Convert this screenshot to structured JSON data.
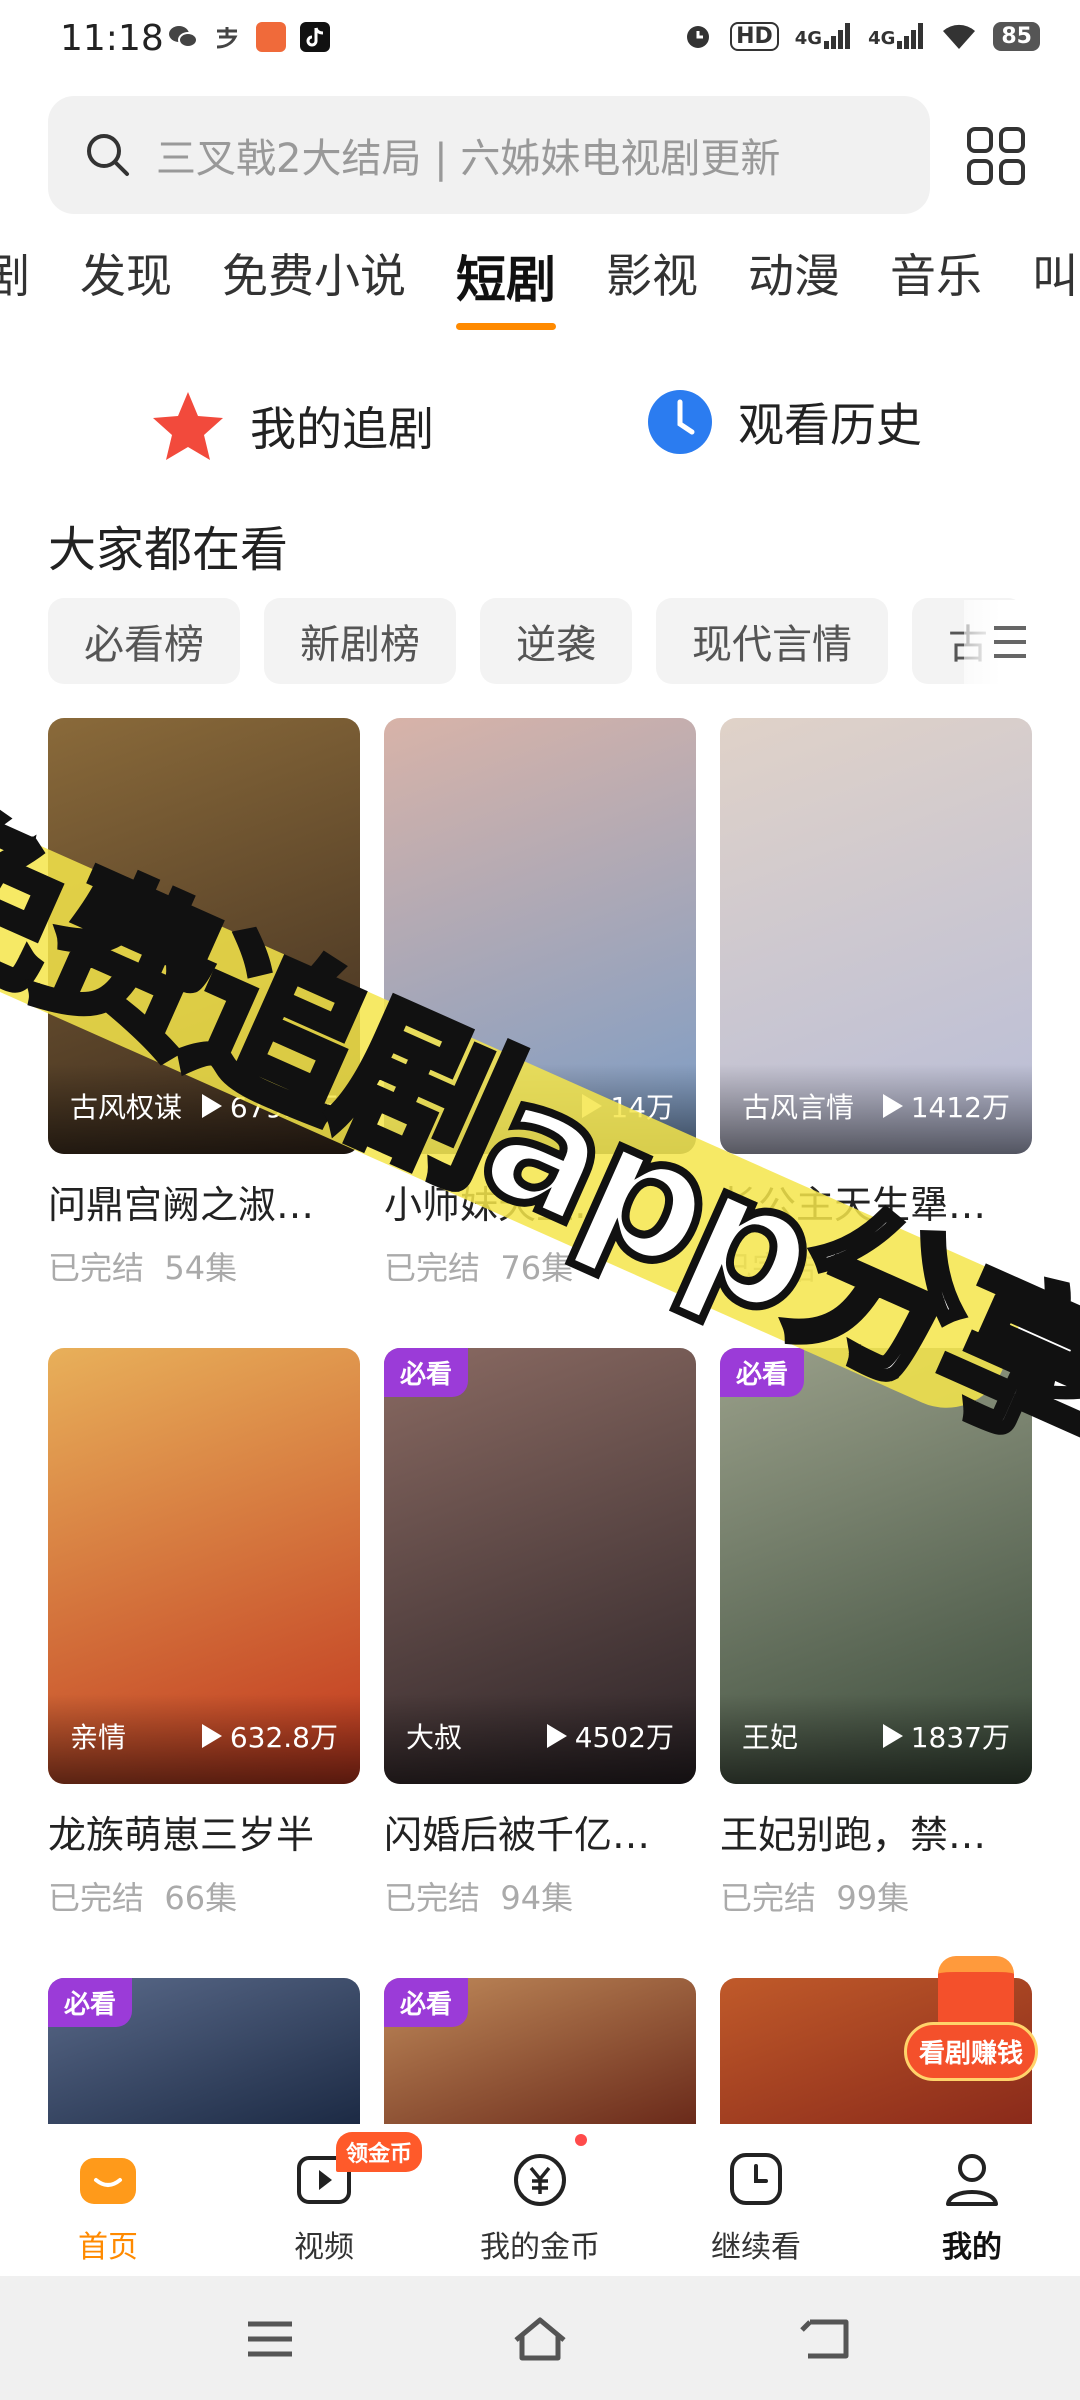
{
  "status_bar": {
    "time": "11:18",
    "battery": "85",
    "network_1": "4G",
    "network_2": "4G",
    "hd": "HD"
  },
  "search": {
    "placeholder": "三叉戟2大结局 | 六姊妹电视剧更新"
  },
  "tabs": [
    {
      "label": "剧",
      "active": false
    },
    {
      "label": "发现",
      "active": false
    },
    {
      "label": "免费小说",
      "active": false
    },
    {
      "label": "短剧",
      "active": true
    },
    {
      "label": "影视",
      "active": false
    },
    {
      "label": "动漫",
      "active": false
    },
    {
      "label": "音乐",
      "active": false
    },
    {
      "label": "叫",
      "active": false
    }
  ],
  "shortcuts": {
    "my_drama": "我的追剧",
    "history": "观看历史"
  },
  "section_title": "大家都在看",
  "chips": [
    "必看榜",
    "新剧榜",
    "逆袭",
    "现代言情",
    "古"
  ],
  "cards": [
    {
      "title": "问鼎宫阙之淑…",
      "tag": "古风权谋",
      "views": "679.6万",
      "status": "已完结",
      "episodes": "54集",
      "badge": "",
      "color_a": "#3a2a1e",
      "color_b": "#8a6a3a"
    },
    {
      "title": "小师妹天生…",
      "tag": "",
      "views": "14万",
      "status": "已完结",
      "episodes": "76集",
      "badge": "",
      "color_a": "#7a9cc6",
      "color_b": "#d8b3a8"
    },
    {
      "title": "长公主天生犟…",
      "tag": "古风言情",
      "views": "1412万",
      "status": "已完结",
      "episodes": "",
      "badge": "",
      "color_a": "#b8bdd8",
      "color_b": "#e0d2c8"
    },
    {
      "title": "龙族萌崽三岁半",
      "tag": "亲情",
      "views": "632.8万",
      "status": "已完结",
      "episodes": "66集",
      "badge": "",
      "color_a": "#c0361e",
      "color_b": "#e8b05a"
    },
    {
      "title": "闪婚后被千亿…",
      "tag": "大叔",
      "views": "4502万",
      "status": "已完结",
      "episodes": "94集",
      "badge": "必看",
      "color_a": "#2a2226",
      "color_b": "#8a6a62"
    },
    {
      "title": "王妃别跑，禁…",
      "tag": "王妃",
      "views": "1837万",
      "status": "已完结",
      "episodes": "99集",
      "badge": "必看",
      "color_a": "#3a4a3a",
      "color_b": "#9aa08a"
    },
    {
      "title": "",
      "tag": "",
      "views": "",
      "status": "",
      "episodes": "",
      "badge": "必看",
      "color_a": "#1c2a44",
      "color_b": "#5a6a8a"
    },
    {
      "title": "",
      "tag": "",
      "views": "",
      "status": "",
      "episodes": "",
      "badge": "必看",
      "color_a": "#6a2a1a",
      "color_b": "#c08a5a"
    },
    {
      "title": "",
      "tag": "",
      "views": "",
      "status": "",
      "episodes": "",
      "badge": "",
      "color_a": "#8a2a1a",
      "color_b": "#c05a2a"
    }
  ],
  "watermark": "免费追剧app分享",
  "earn_button": "看剧赚钱",
  "bottom_nav": [
    {
      "label": "首页",
      "icon": "home-icon",
      "active": true
    },
    {
      "label": "视频",
      "icon": "video-icon",
      "badge": "领金币"
    },
    {
      "label": "我的金币",
      "icon": "coin-icon"
    },
    {
      "label": "继续看",
      "icon": "clock-icon"
    },
    {
      "label": "我的",
      "icon": "profile-icon"
    }
  ],
  "colors": {
    "accent": "#ff8a00",
    "badge_purple": "#9b3bd8",
    "earn_red": "#f4502b"
  }
}
